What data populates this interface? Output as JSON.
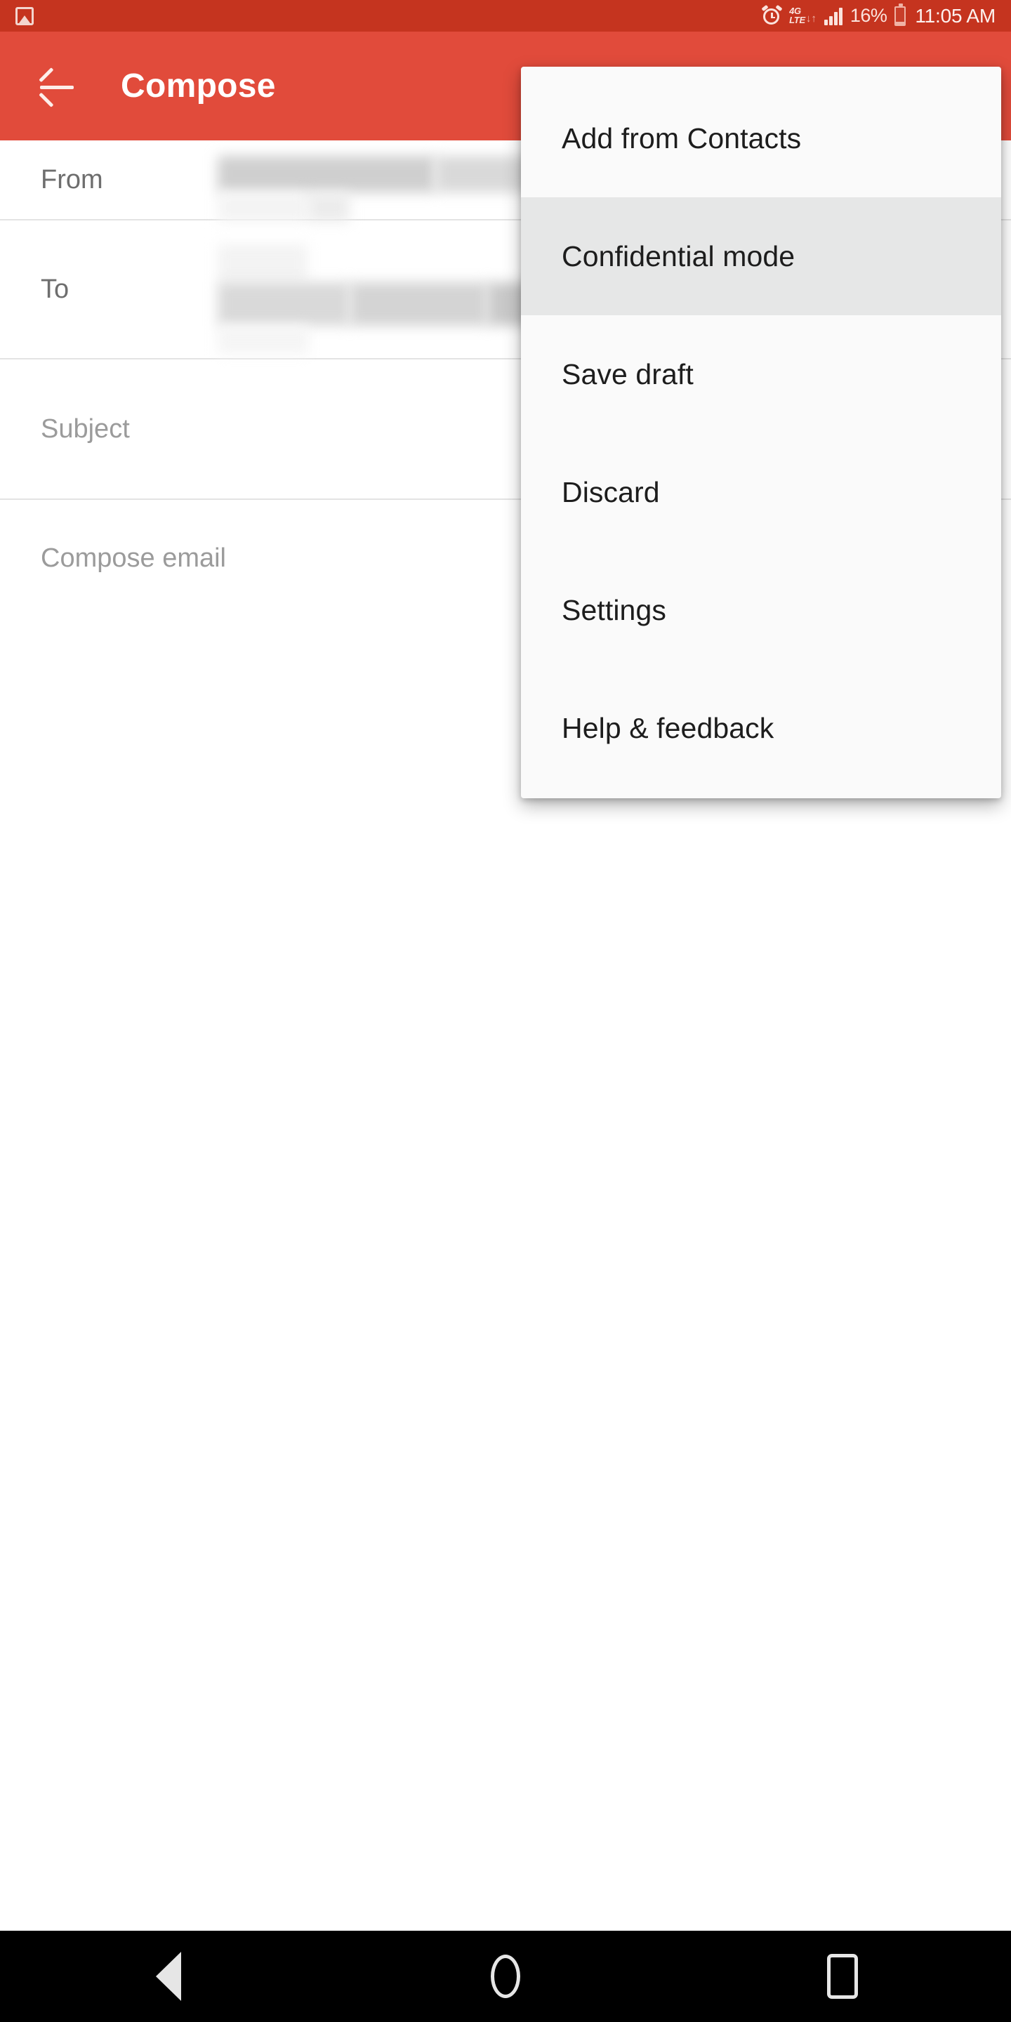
{
  "status_bar": {
    "left_icons": [
      "photo-icon"
    ],
    "alarm_icon": "alarm-clock-icon",
    "network_type_line1": "4G",
    "network_type_line2": "LTE",
    "data_arrows": "↓↑",
    "signal_icon": "signal-bars-icon",
    "battery_percent": "16%",
    "battery_icon": "battery-icon",
    "time": "11:05 AM",
    "background_color": "#c5341f",
    "text_color": "#fbe3dd"
  },
  "app_bar": {
    "back_label": "back-arrow",
    "title": "Compose",
    "background_color": "#e14b3b",
    "title_color": "#ffffff"
  },
  "compose_form": {
    "from": {
      "label": "From",
      "value": "",
      "redacted": true
    },
    "to": {
      "label": "To",
      "value": "",
      "redacted": true,
      "visible_fragment": "k"
    },
    "subject": {
      "label": "",
      "placeholder": "Subject",
      "value": ""
    },
    "body": {
      "label": "",
      "placeholder": "Compose email",
      "value": ""
    },
    "divider_color": "#e3e3e3",
    "placeholder_color": "#9b9b9b",
    "label_color": "#6e6e6e"
  },
  "overflow_menu": {
    "visible": true,
    "background_color": "#fafafa",
    "highlight_color": "#e6e7e7",
    "text_color": "#1d1d1d",
    "items": [
      {
        "label": "Add from Contacts",
        "highlighted": false
      },
      {
        "label": "Confidential mode",
        "highlighted": true
      },
      {
        "label": "Save draft",
        "highlighted": false
      },
      {
        "label": "Discard",
        "highlighted": false
      },
      {
        "label": "Settings",
        "highlighted": false
      },
      {
        "label": "Help & feedback",
        "highlighted": false
      }
    ]
  },
  "nav_bar": {
    "background_color": "#000000",
    "icon_color": "#e6e6e6",
    "buttons": [
      {
        "name": "back",
        "icon": "triangle-back-icon"
      },
      {
        "name": "home",
        "icon": "circle-home-icon"
      },
      {
        "name": "recents",
        "icon": "square-recents-icon"
      }
    ]
  }
}
